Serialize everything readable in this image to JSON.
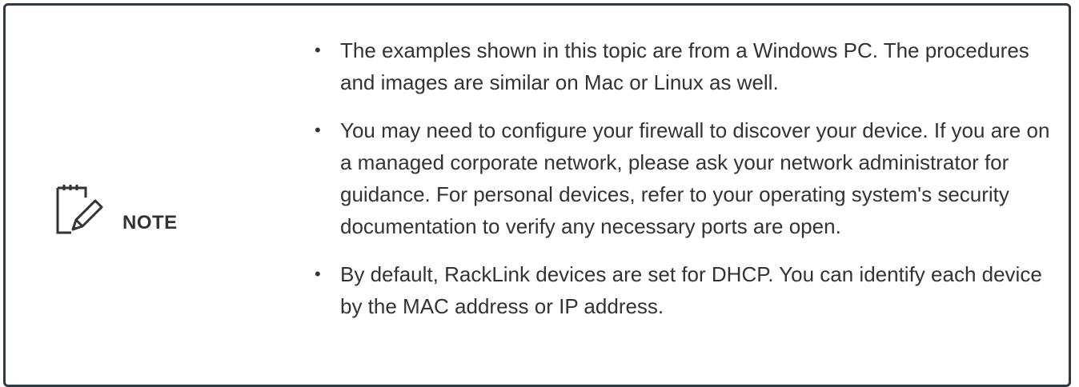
{
  "note": {
    "label": "NOTE",
    "icon": "note-pencil-icon",
    "border_color": "#2f3a45",
    "items": [
      "The examples shown in this topic are from a Windows PC. The procedures and images are similar on Mac or Linux as well.",
      "You may need to configure your firewall to discover your device. If you are on a managed corporate network, please ask your network administrator for guidance. For personal devices, refer to your operating system's security documentation to verify any necessary ports are open.",
      "By default, RackLink devices are set for DHCP. You can identify each device by the MAC address or IP address."
    ]
  }
}
